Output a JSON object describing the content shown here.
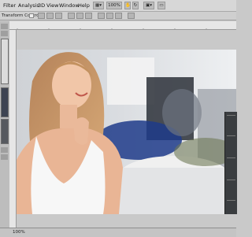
{
  "menu": [
    "Filter",
    "Analysis",
    "3D",
    "View",
    "Window",
    "Help"
  ],
  "toolbar": {
    "zoom_value": "100%",
    "option_label": "Transform Controls"
  },
  "status": {
    "zoom": "100%"
  },
  "colors": {
    "menubar_bg": "#d7d7d7",
    "canvas_bg": "#e8e8ea",
    "panel_bg": "#3a3d40"
  },
  "icons": [
    "move-icon",
    "layout-icon",
    "align-icon",
    "arrange-icon",
    "hand-icon",
    "zoom-icon",
    "rotate-icon"
  ]
}
